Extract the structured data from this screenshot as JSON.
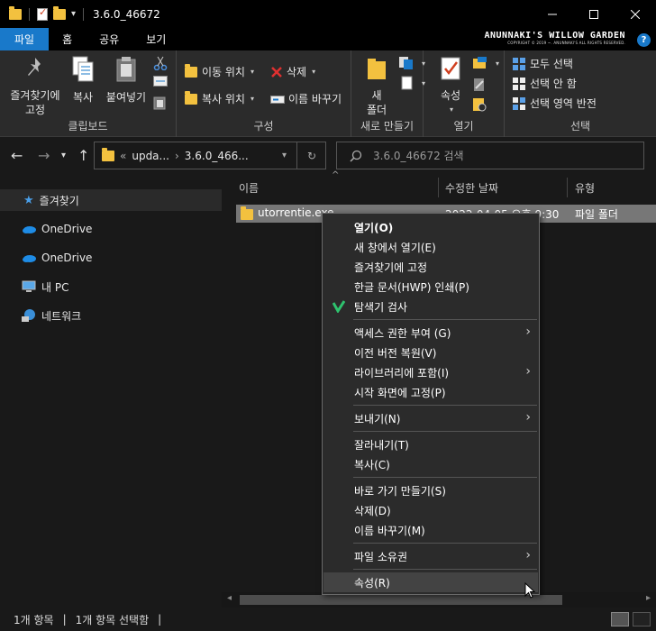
{
  "window": {
    "title": "3.6.0_46672",
    "controls": [
      "minimize",
      "maximize",
      "close"
    ]
  },
  "ribbon_tabs": [
    "파일",
    "홈",
    "공유",
    "보기"
  ],
  "brand": {
    "main": "ANUNNAKI'S WILLOW GARDEN",
    "sub": "COPYRIGHT © 2019 ~. ANUNNAKI'S ALL RIGHTS RESERVED."
  },
  "ribbon": {
    "clipboard": {
      "label": "클립보드",
      "pin": "즐겨찾기에\n고정",
      "copy": "복사",
      "paste": "붙여넣기"
    },
    "organize": {
      "label": "구성",
      "move_to": "이동 위치",
      "copy_to": "복사 위치",
      "delete": "삭제",
      "rename": "이름 바꾸기"
    },
    "new": {
      "label": "새로 만들기",
      "new_folder": "새\n폴더"
    },
    "open": {
      "label": "열기",
      "properties": "속성"
    },
    "select": {
      "label": "선택",
      "select_all": "모두 선택",
      "select_none": "선택 안 함",
      "invert": "선택 영역 반전"
    }
  },
  "address": {
    "path_prefix": "«",
    "crumbs": [
      "upda...",
      "3.6.0_466..."
    ],
    "search_placeholder": "3.6.0_46672 검색"
  },
  "navpane": {
    "items": [
      "즐겨찾기",
      "OneDrive",
      "OneDrive",
      "내 PC",
      "네트워크"
    ]
  },
  "columns": [
    "이름",
    "수정한 날짜",
    "유형"
  ],
  "files": [
    {
      "name": "utorrentie.exe",
      "date": "2022-04-05 오후 9:30",
      "type": "파일 폴더"
    }
  ],
  "context_menu": {
    "groups": [
      [
        {
          "label": "열기(O)",
          "bold": true
        },
        {
          "label": "새 창에서 열기(E)"
        },
        {
          "label": "즐겨찾기에 고정"
        },
        {
          "label": "한글 문서(HWP) 인쇄(P)"
        },
        {
          "label": "탐색기 검사",
          "icon": "defender-icon"
        }
      ],
      [
        {
          "label": "액세스 권한 부여 (G)",
          "submenu": true
        },
        {
          "label": "이전 버전 복원(V)"
        },
        {
          "label": "라이브러리에 포함(I)",
          "submenu": true
        },
        {
          "label": "시작 화면에 고정(P)"
        }
      ],
      [
        {
          "label": "보내기(N)",
          "submenu": true
        }
      ],
      [
        {
          "label": "잘라내기(T)"
        },
        {
          "label": "복사(C)"
        }
      ],
      [
        {
          "label": "바로 가기 만들기(S)"
        },
        {
          "label": "삭제(D)"
        },
        {
          "label": "이름 바꾸기(M)"
        }
      ],
      [
        {
          "label": "파일 소유권",
          "submenu": true
        }
      ],
      [
        {
          "label": "속성(R)",
          "hover": true
        }
      ]
    ]
  },
  "status": {
    "count": "1개 항목",
    "selected": "1개 항목 선택함",
    "sep": "|"
  },
  "colors": {
    "accent": "#1979ca",
    "folder": "#f3c13f",
    "background": "#191919",
    "menu_bg": "#2b2b2b"
  }
}
